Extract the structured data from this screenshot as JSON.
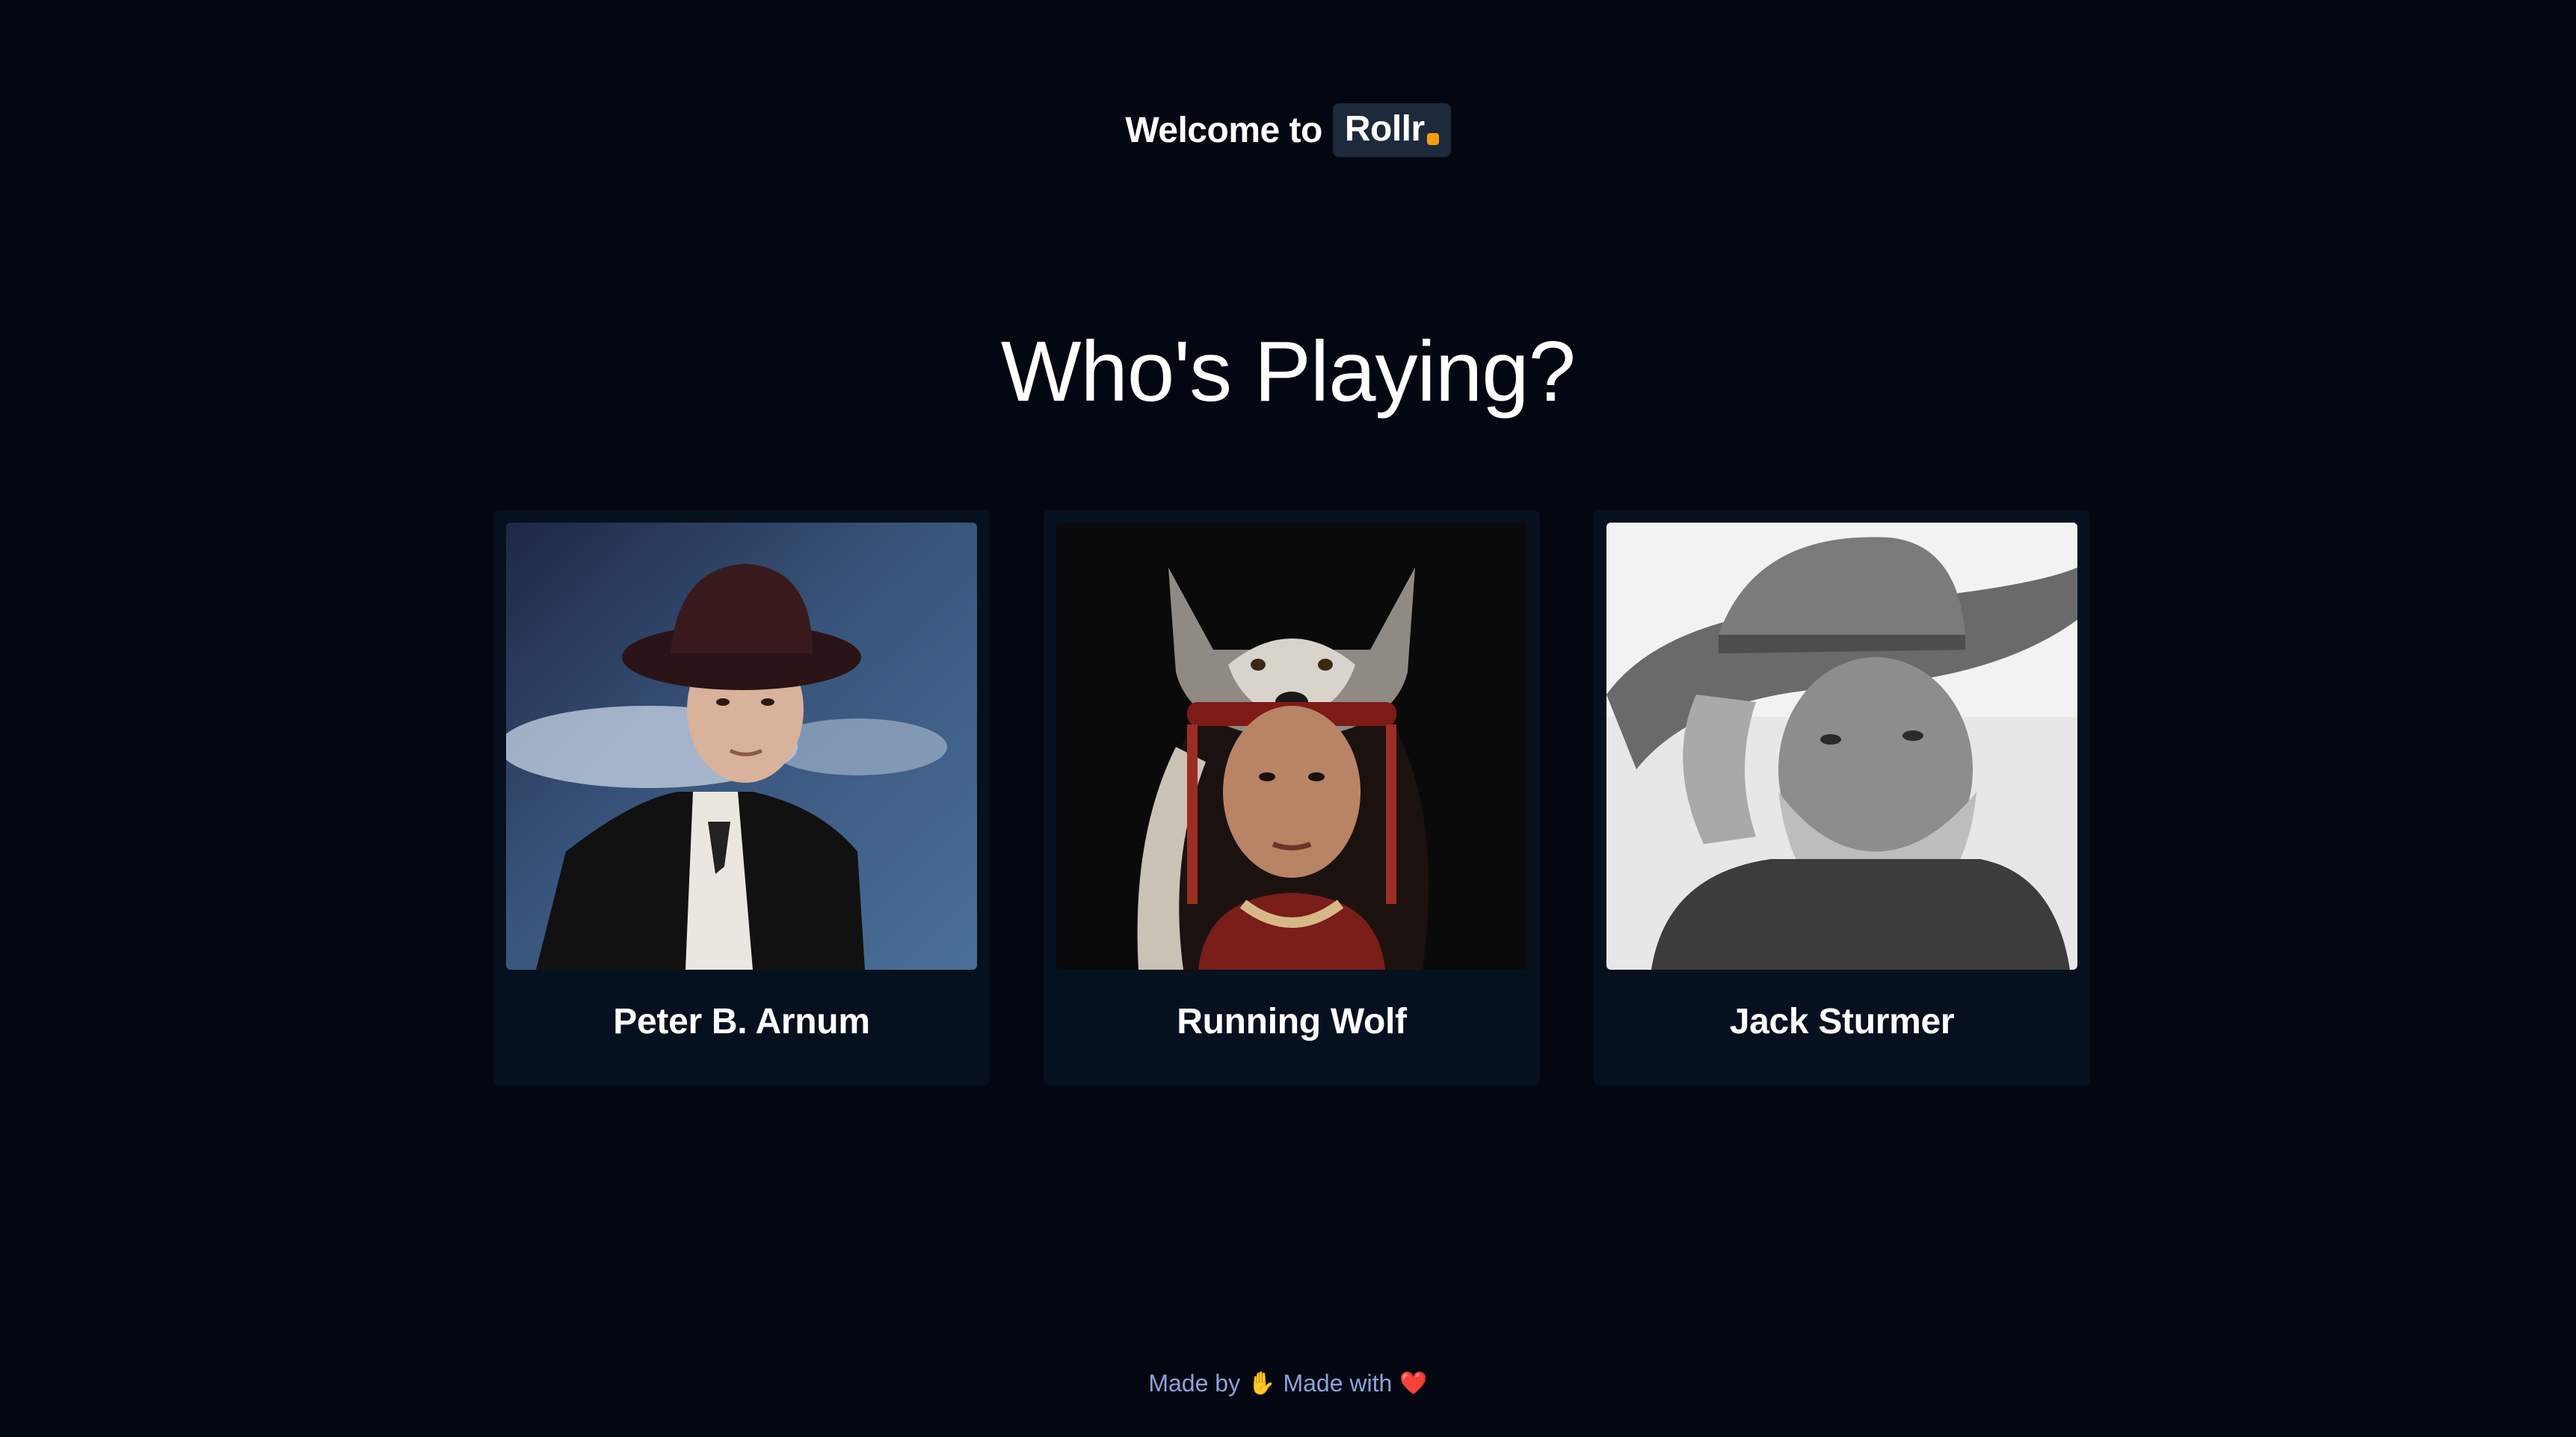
{
  "header": {
    "welcome_text": "Welcome to",
    "brand_name": "Rollr",
    "brand_dot_color": "#f59e0b"
  },
  "main": {
    "title": "Who's Playing?",
    "players": [
      {
        "name": "Peter B. Arnum",
        "portrait_icon": "cowboy-portrait"
      },
      {
        "name": "Running Wolf",
        "portrait_icon": "wolf-headdress-portrait"
      },
      {
        "name": "Jack Sturmer",
        "portrait_icon": "old-cowboy-portrait"
      }
    ]
  },
  "footer": {
    "made_by_label": "Made by",
    "hand_icon": "✋",
    "made_with_label": "Made with",
    "heart_icon": "❤️"
  }
}
